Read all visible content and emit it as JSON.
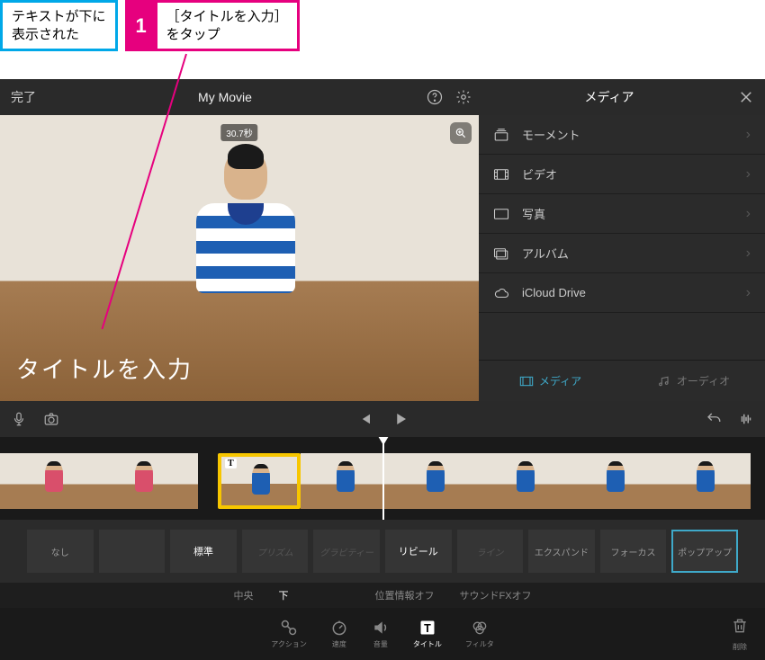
{
  "callouts": {
    "blue": "テキストが下に\n表示された",
    "pink_num": "1",
    "pink_text": "［タイトルを入力］\nをタップ"
  },
  "topbar": {
    "done": "完了",
    "title": "My Movie",
    "media_header": "メディア"
  },
  "preview": {
    "duration_badge": "30.7秒",
    "title_overlay": "タイトルを入力"
  },
  "media_items": [
    {
      "label": "モーメント",
      "icon": "stack"
    },
    {
      "label": "ビデオ",
      "icon": "film"
    },
    {
      "label": "写真",
      "icon": "photo"
    },
    {
      "label": "アルバム",
      "icon": "album"
    },
    {
      "label": "iCloud Drive",
      "icon": "cloud"
    }
  ],
  "side_tabs": {
    "media": "メディア",
    "audio": "オーディオ"
  },
  "timeline": {
    "t_badge": "T"
  },
  "title_styles": [
    {
      "label": "なし",
      "cls": ""
    },
    {
      "label": "",
      "cls": ""
    },
    {
      "label": "標準",
      "cls": "bright"
    },
    {
      "label": "プリズム",
      "cls": "dim"
    },
    {
      "label": "グラビティー",
      "cls": "dim"
    },
    {
      "label": "リビール",
      "cls": "bright"
    },
    {
      "label": "ライン",
      "cls": "dim"
    },
    {
      "label": "エクスパンド",
      "cls": ""
    },
    {
      "label": "フォーカス",
      "cls": ""
    },
    {
      "label": "ポップアップ",
      "cls": "selected"
    }
  ],
  "options": {
    "center": "中央",
    "bottom": "下",
    "location_off": "位置情報オフ",
    "soundfx_off": "サウンドFXオフ"
  },
  "tools": {
    "action": "アクション",
    "speed": "速度",
    "volume": "音量",
    "title": "タイトル",
    "filter": "フィルタ",
    "delete": "削除"
  }
}
